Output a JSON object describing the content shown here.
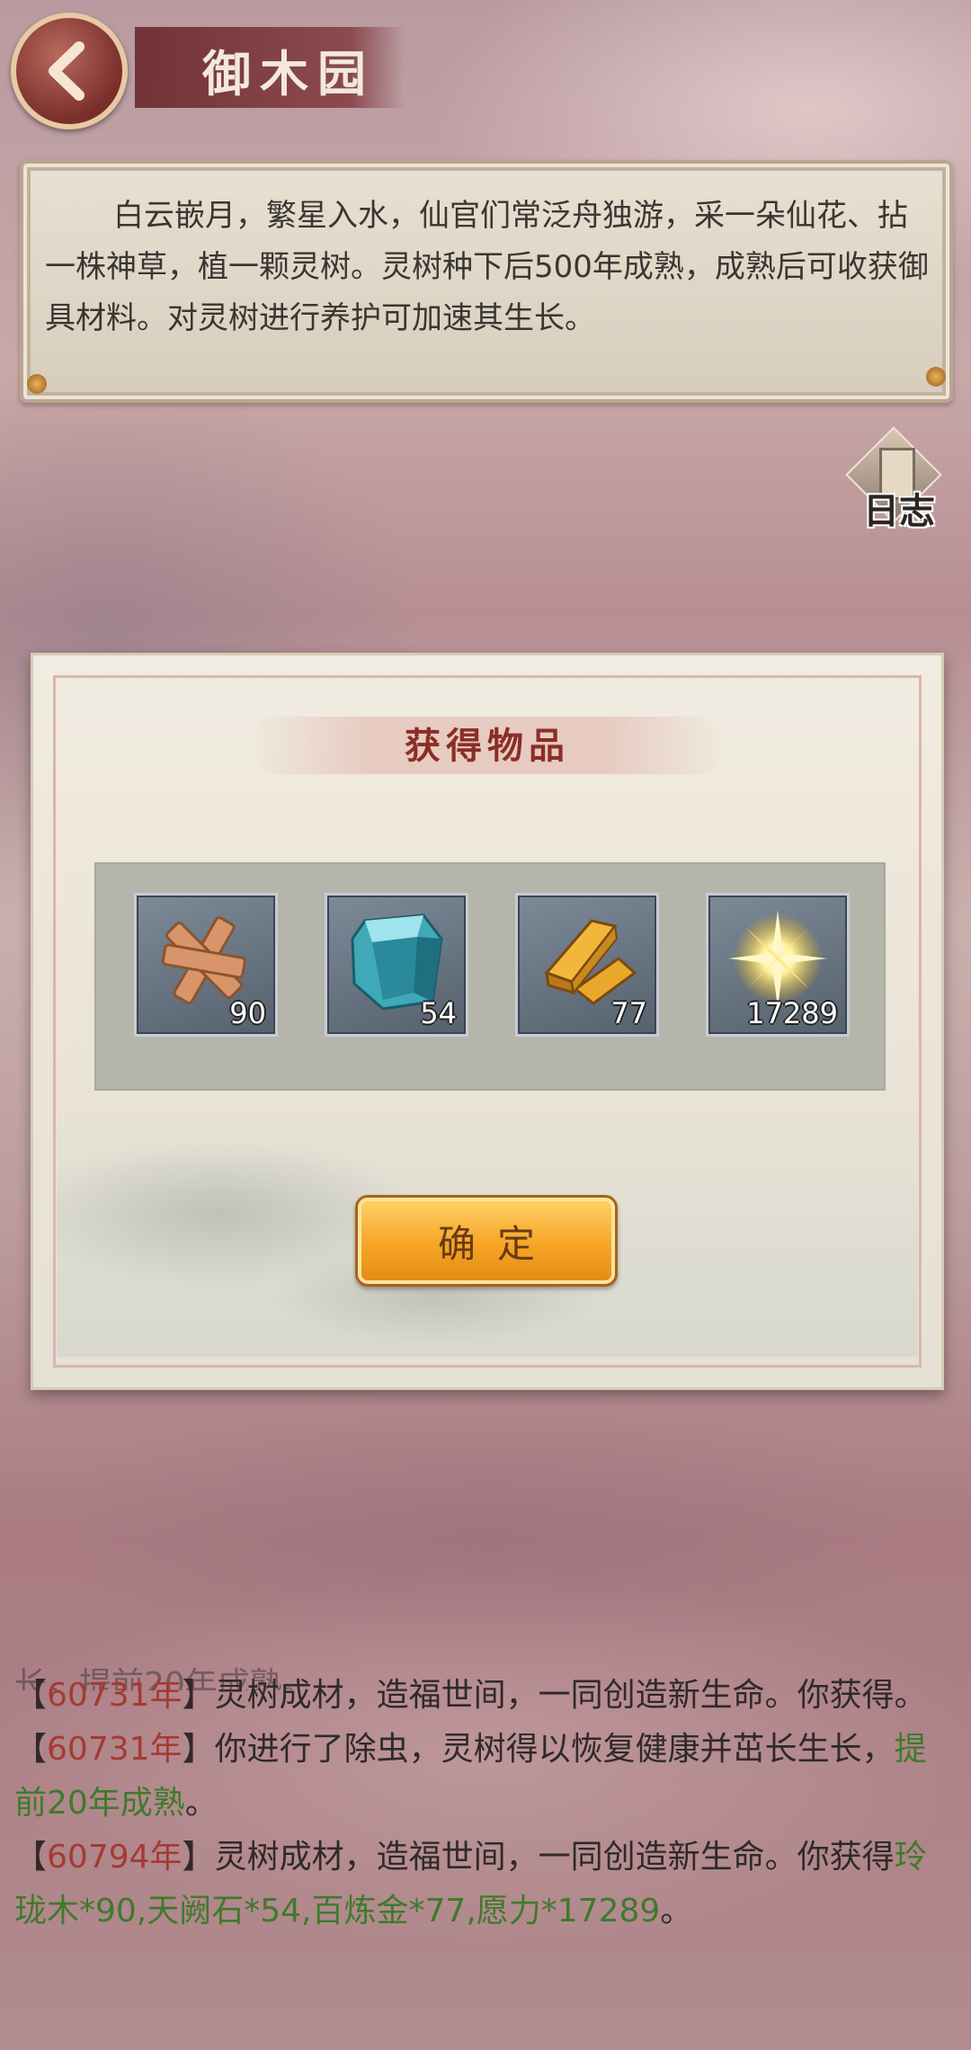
{
  "header": {
    "title": "御木园",
    "back_icon": "chevron-left-icon"
  },
  "intro": {
    "text": "白云嵌月，繁星入水，仙官们常泛舟独游，采一朵仙花、拈一株神草，植一颗灵树。灵树种下后500年成熟，成熟后可收获御具材料。对灵树进行养护可加速其生长。"
  },
  "log_button": {
    "label": "日志",
    "icon": "scroll-icon"
  },
  "modal": {
    "title": "获得物品",
    "items": [
      {
        "icon": "wood-knot-icon",
        "count": "90"
      },
      {
        "icon": "crystal-stone-icon",
        "count": "54"
      },
      {
        "icon": "gold-bar-icon",
        "count": "77"
      },
      {
        "icon": "sparkle-icon",
        "count": "17289"
      }
    ],
    "confirm_label": "确定"
  },
  "log": {
    "partial_line": "长，提前20年成熟。",
    "entries": [
      {
        "year": "60731年",
        "text": "灵树成材，造福世间，一同创造新生命。你获得。"
      },
      {
        "year": "60731年",
        "text": "你进行了除虫，灵树得以恢复健康并茁长生长，",
        "highlight": "提前20年成熟",
        "tail": "。"
      },
      {
        "year": "60794年",
        "text": "灵树成材，造福世间，一同创造新生命。你获得",
        "highlight": "玲珑木*90,天阙石*54,百炼金*77,愿力*17289",
        "tail": "。"
      }
    ],
    "bracket_open": "【",
    "bracket_close": "】"
  },
  "colors": {
    "year": "#a53a32",
    "reward": "#3f7a2a",
    "title": "#8a2f26",
    "button": "#f6a526"
  }
}
